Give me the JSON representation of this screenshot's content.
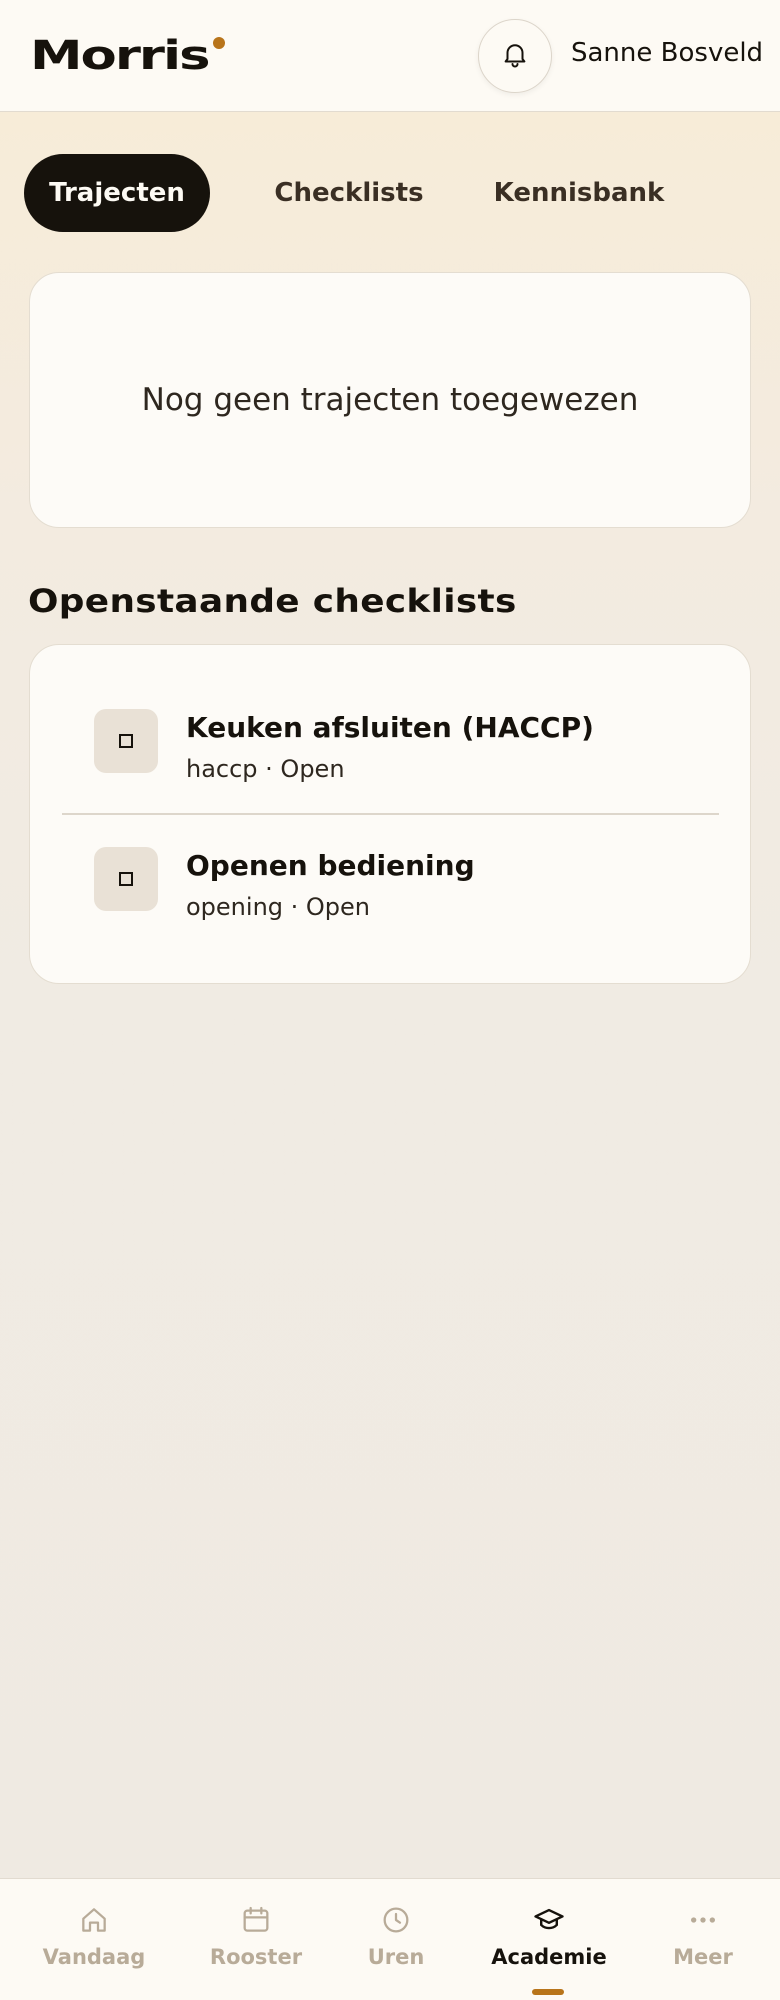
{
  "header": {
    "logo": "Morris",
    "user_name": "Sanne Bosveld",
    "bell_icon": "bell-icon",
    "accent_color": "#b8741a"
  },
  "tabs": [
    {
      "label": "Trajecten",
      "active": true
    },
    {
      "label": "Checklists",
      "active": false
    },
    {
      "label": "Kennisbank",
      "active": false
    }
  ],
  "empty_state": {
    "text": "Nog geen trajecten toegewezen"
  },
  "open_checklists": {
    "title": "Openstaande checklists",
    "items": [
      {
        "title": "Keuken afsluiten (HACCP)",
        "subtitle": "haccp · Open",
        "icon": "checkbox-icon"
      },
      {
        "title": "Openen bediening",
        "subtitle": "opening · Open",
        "icon": "checkbox-icon"
      }
    ]
  },
  "bottom_nav": [
    {
      "label": "Vandaag",
      "icon": "home-icon",
      "active": false
    },
    {
      "label": "Rooster",
      "icon": "calendar-icon",
      "active": false
    },
    {
      "label": "Uren",
      "icon": "clock-icon",
      "active": false
    },
    {
      "label": "Academie",
      "icon": "graduation-cap-icon",
      "active": true
    },
    {
      "label": "Meer",
      "icon": "more-icon",
      "active": false
    }
  ]
}
